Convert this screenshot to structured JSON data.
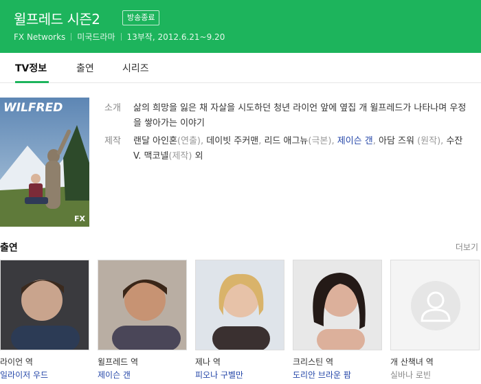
{
  "header": {
    "title": "윌프레드 시즌2",
    "badge": "방송종료",
    "network": "FX Networks",
    "genre": "미국드라마",
    "episodes": "13부작, 2012.6.21~9.20"
  },
  "tabs": [
    {
      "label": "TV정보",
      "active": true
    },
    {
      "label": "출연",
      "active": false
    },
    {
      "label": "시리즈",
      "active": false
    }
  ],
  "poster": {
    "title": "WILFRED",
    "logo": "FX"
  },
  "info": {
    "intro_label": "소개",
    "intro_text": "삶의 희망을 잃은 채 자살을 시도하던 청년 라이언 앞에 옆집 개 윌프레드가 나타나며 우정을 쌓아가는 이야기",
    "credits_label": "제작",
    "credits": [
      {
        "name": "랜달 아인혼",
        "role": "(연출), "
      },
      {
        "name": "데이빗 주커맨",
        "role": ", "
      },
      {
        "name": "리드 애그뉴",
        "role": "(극본), "
      },
      {
        "name": "제이슨 갠",
        "role": ", ",
        "link": true
      },
      {
        "name": "아담 즈워",
        "role": " (원작), "
      },
      {
        "name": "수잔 V. 맥코넬",
        "role": "(제작) "
      },
      {
        "name": "외",
        "role": ""
      }
    ]
  },
  "cast": {
    "heading": "출연",
    "more": "더보기",
    "members": [
      {
        "character": "라이언 역",
        "actor": "일라이저 우드",
        "linked": true
      },
      {
        "character": "윌프레드 역",
        "actor": "제이슨 갠",
        "linked": true
      },
      {
        "character": "제나 역",
        "actor": "피오나 구벨만",
        "linked": true
      },
      {
        "character": "크리스틴 역",
        "actor": "도리안 브라운 팜",
        "linked": true
      },
      {
        "character": "개 산책녀 역",
        "actor": "실바나 로빈",
        "linked": false
      }
    ]
  },
  "colors": {
    "accent": "#1db45c",
    "link": "#2446a8"
  }
}
